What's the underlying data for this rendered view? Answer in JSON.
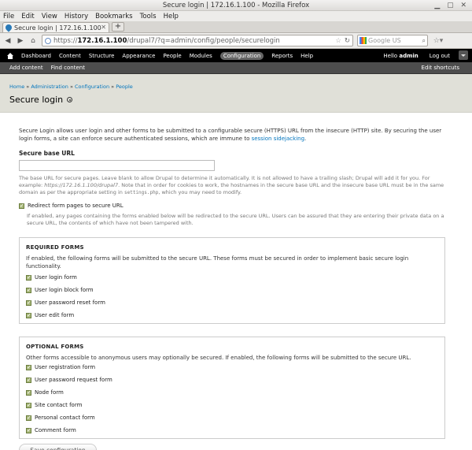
{
  "window": {
    "title": "Secure login | 172.16.1.100 - Mozilla Firefox"
  },
  "menubar": {
    "items": [
      "File",
      "Edit",
      "View",
      "History",
      "Bookmarks",
      "Tools",
      "Help"
    ]
  },
  "tabs": [
    {
      "label": "Secure login | 172.16.1.100"
    }
  ],
  "newtab_label": "+",
  "urlbar": {
    "scheme": "https://",
    "host": "172.16.1.100",
    "path": "/drupal7/?q=admin/config/people/securelogin"
  },
  "search": {
    "placeholder": "Google US"
  },
  "toolbar": {
    "nav": [
      "Dashboard",
      "Content",
      "Structure",
      "Appearance",
      "People",
      "Modules",
      "Configuration",
      "Reports",
      "Help"
    ],
    "active": "Configuration",
    "hello_prefix": "Hello ",
    "user": "admin",
    "logout": "Log out"
  },
  "shortcuts": {
    "items": [
      "Add content",
      "Find content"
    ],
    "edit": "Edit shortcuts"
  },
  "breadcrumb": [
    "Home",
    "Administration",
    "Configuration",
    "People"
  ],
  "breadcrumb_sep": " » ",
  "page_title": "Secure login",
  "intro": {
    "text": "Secure Login allows user login and other forms to be submitted to a configurable secure (HTTPS) URL from the insecure (HTTP) site. By securing the user login forms, a site can enforce secure authenticated sessions, which are immune to ",
    "link": "session sidejacking",
    "end": "."
  },
  "base_url": {
    "label": "Secure base URL",
    "value": "",
    "desc_a": "The base URL for secure pages. Leave blank to allow Drupal to determine it automatically. It is not allowed to have a trailing slash; Drupal will add it for you. For example: ",
    "desc_example": "https://172.16.1.100/drupal7",
    "desc_b": ". Note that in order for cookies to work, the hostnames in the secure base URL and the insecure base URL must be in the same domain as per the appropriate setting in ",
    "desc_code": "settings.php",
    "desc_c": ", which you may need to modify."
  },
  "redirect": {
    "label": "Redirect form pages to secure URL",
    "checked": true,
    "desc": "If enabled, any pages containing the forms enabled below will be redirected to the secure URL. Users can be assured that they are entering their private data on a secure URL, the contents of which have not been tampered with."
  },
  "required_forms": {
    "title": "REQUIRED FORMS",
    "desc": "If enabled, the following forms will be submitted to the secure URL. These forms must be secured in order to implement basic secure login functionality.",
    "items": [
      "User login form",
      "User login block form",
      "User password reset form",
      "User edit form"
    ]
  },
  "optional_forms": {
    "title": "OPTIONAL FORMS",
    "desc": "Other forms accessible to anonymous users may optionally be secured. If enabled, the following forms will be submitted to the secure URL.",
    "items": [
      "User registration form",
      "User password request form",
      "Node form",
      "Site contact form",
      "Personal contact form",
      "Comment form"
    ]
  },
  "save_label": "Save configuration"
}
